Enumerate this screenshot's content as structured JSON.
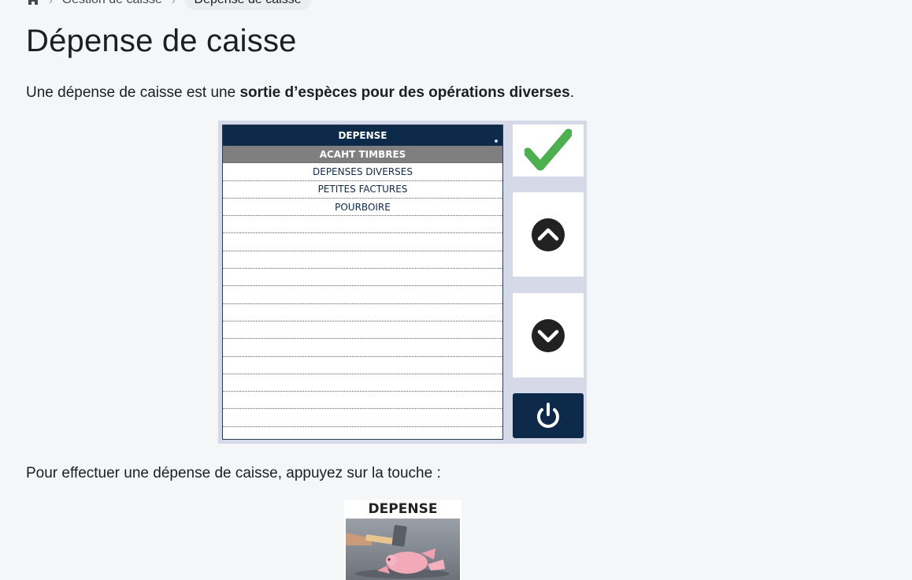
{
  "breadcrumb": {
    "items": [
      "Gestion de caisse",
      "Dépense de caisse"
    ]
  },
  "page": {
    "title": "Dépense de caisse",
    "intro_prefix": "Une dépense de caisse est une ",
    "intro_bold": "sortie d’espèces pour des opérations diverses",
    "intro_suffix": ".",
    "instruction": "Pour effectuer une dépense de caisse, appuyez sur la touche :"
  },
  "pos_screen": {
    "list_header": "DEPENSE",
    "items": [
      "ACAHT TIMBRES",
      "DEPENSES DIVERSES",
      "PETITES FACTURES",
      "POURBOIRE"
    ],
    "selected_index": 0,
    "empty_rows": 12,
    "buttons": {
      "validate": "check-icon",
      "up": "arrow-up-icon",
      "down": "arrow-down-icon",
      "exit": "power-icon"
    },
    "colors": {
      "header": "#0e2a4a",
      "check": "#4caf50",
      "selected_row": "#7f7f7f"
    }
  },
  "key": {
    "label": "DEPENSE"
  }
}
